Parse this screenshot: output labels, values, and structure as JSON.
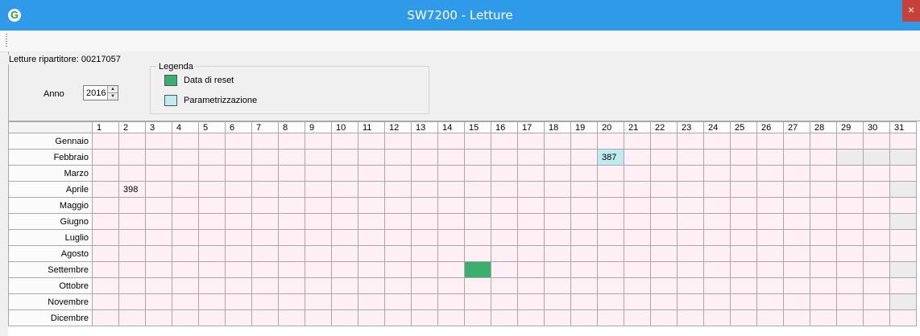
{
  "window": {
    "title": "SW7200 -  Letture",
    "close_glyph": "×",
    "app_icon_glyph": "G"
  },
  "panel": {
    "label": "Letture ripartitore: 00217057",
    "anno_label": "Anno",
    "anno_value": "2016",
    "legend": {
      "title": "Legenda",
      "items": [
        {
          "label": "Data di reset",
          "color": "#3cae6f"
        },
        {
          "label": "Parametrizzazione",
          "color": "#bfeaf0"
        }
      ]
    }
  },
  "grid": {
    "days": [
      "1",
      "2",
      "3",
      "4",
      "5",
      "6",
      "7",
      "8",
      "9",
      "10",
      "11",
      "12",
      "13",
      "14",
      "15",
      "16",
      "17",
      "18",
      "19",
      "20",
      "21",
      "22",
      "23",
      "24",
      "25",
      "26",
      "27",
      "28",
      "29",
      "30",
      "31"
    ],
    "months": [
      {
        "name": "Gennaio",
        "days_in_month": 31
      },
      {
        "name": "Febbraio",
        "days_in_month": 28
      },
      {
        "name": "Marzo",
        "days_in_month": 31
      },
      {
        "name": "Aprile",
        "days_in_month": 30
      },
      {
        "name": "Maggio",
        "days_in_month": 31
      },
      {
        "name": "Giugno",
        "days_in_month": 30
      },
      {
        "name": "Luglio",
        "days_in_month": 31
      },
      {
        "name": "Agosto",
        "days_in_month": 31
      },
      {
        "name": "Settembre",
        "days_in_month": 30
      },
      {
        "name": "Ottobre",
        "days_in_month": 31
      },
      {
        "name": "Novembre",
        "days_in_month": 30
      },
      {
        "name": "Dicembre",
        "days_in_month": 31
      }
    ],
    "marks": [
      {
        "month": "Febbraio",
        "day": 20,
        "value": "387",
        "type": "param"
      },
      {
        "month": "Aprile",
        "day": 2,
        "value": "398",
        "type": ""
      },
      {
        "month": "Settembre",
        "day": 15,
        "value": "",
        "type": "reset"
      }
    ]
  }
}
